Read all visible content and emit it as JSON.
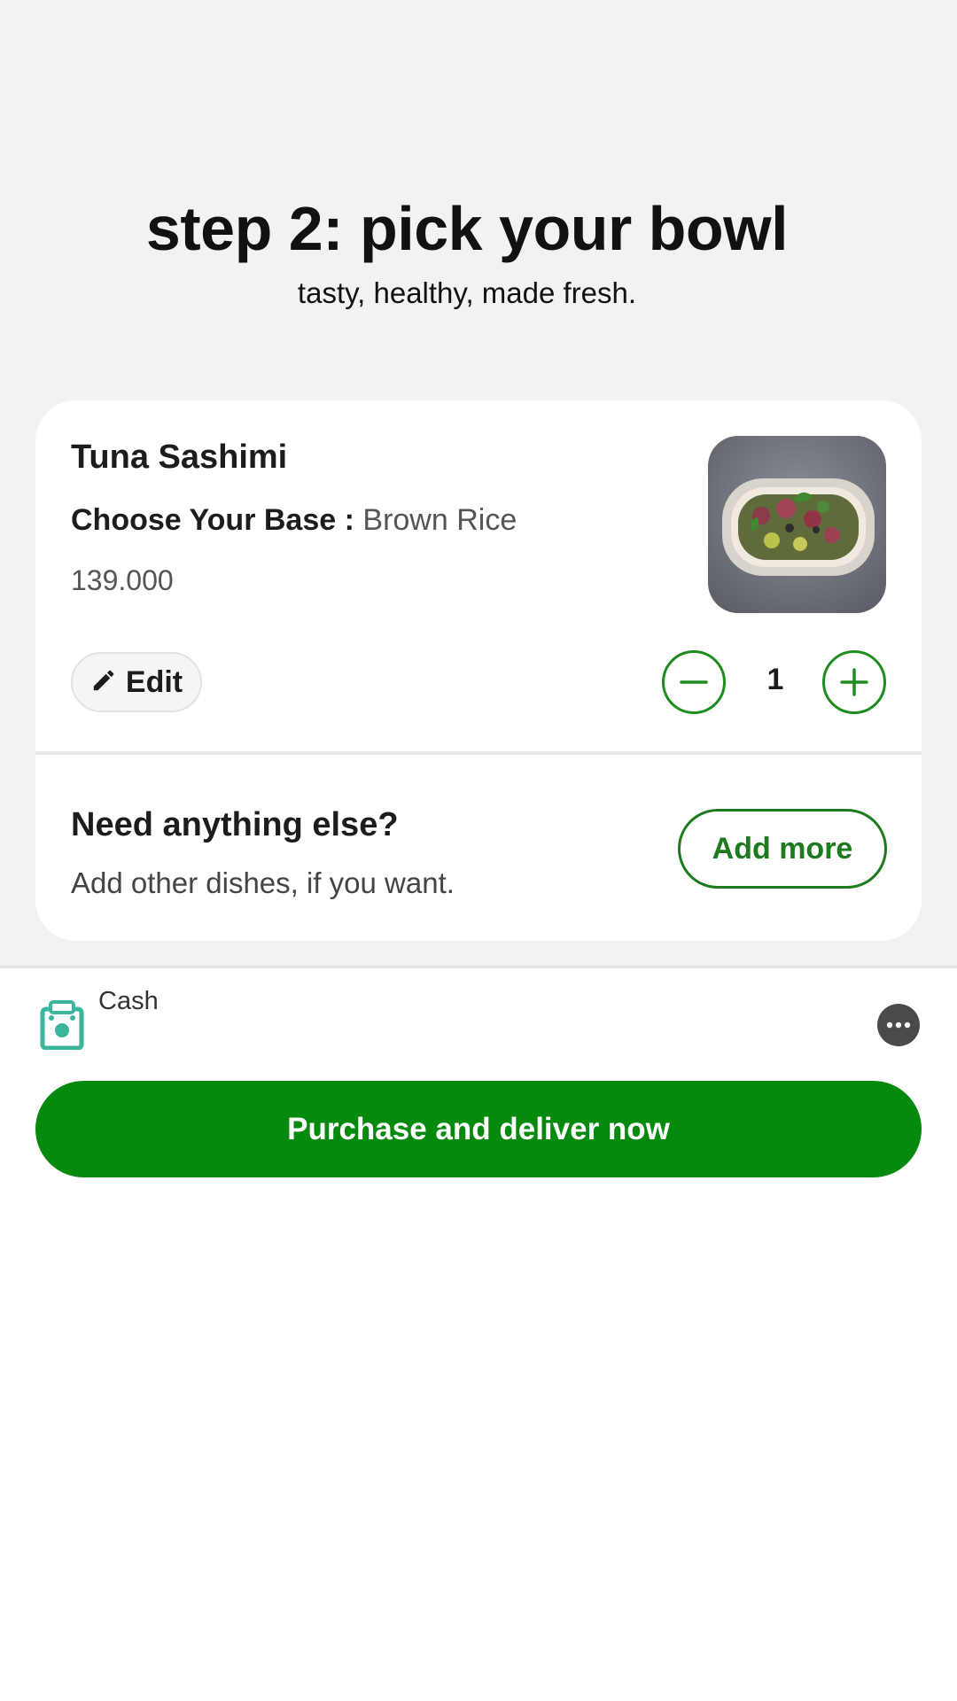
{
  "header": {
    "title": "step 2: pick your bowl",
    "subtitle": "tasty, healthy, made fresh."
  },
  "cart_item": {
    "name": "Tuna Sashimi",
    "option_label": "Choose Your Base :",
    "option_value": "Brown Rice",
    "price": "139.000",
    "edit_label": "Edit",
    "quantity": "1",
    "image_icon": "poke-bowl-photo"
  },
  "upsell": {
    "title": "Need anything else?",
    "subtitle": "Add other dishes, if you want.",
    "button_label": "Add more"
  },
  "payment": {
    "method_label": "Cash",
    "method_icon": "cash-icon",
    "more_icon": "ellipsis-icon"
  },
  "checkout": {
    "button_label": "Purchase and deliver now"
  },
  "colors": {
    "accent_green": "#068a0d",
    "outline_green": "#1e8c1e",
    "background_gray": "#f1f2f4",
    "cash_icon_teal": "#3bb59c"
  }
}
